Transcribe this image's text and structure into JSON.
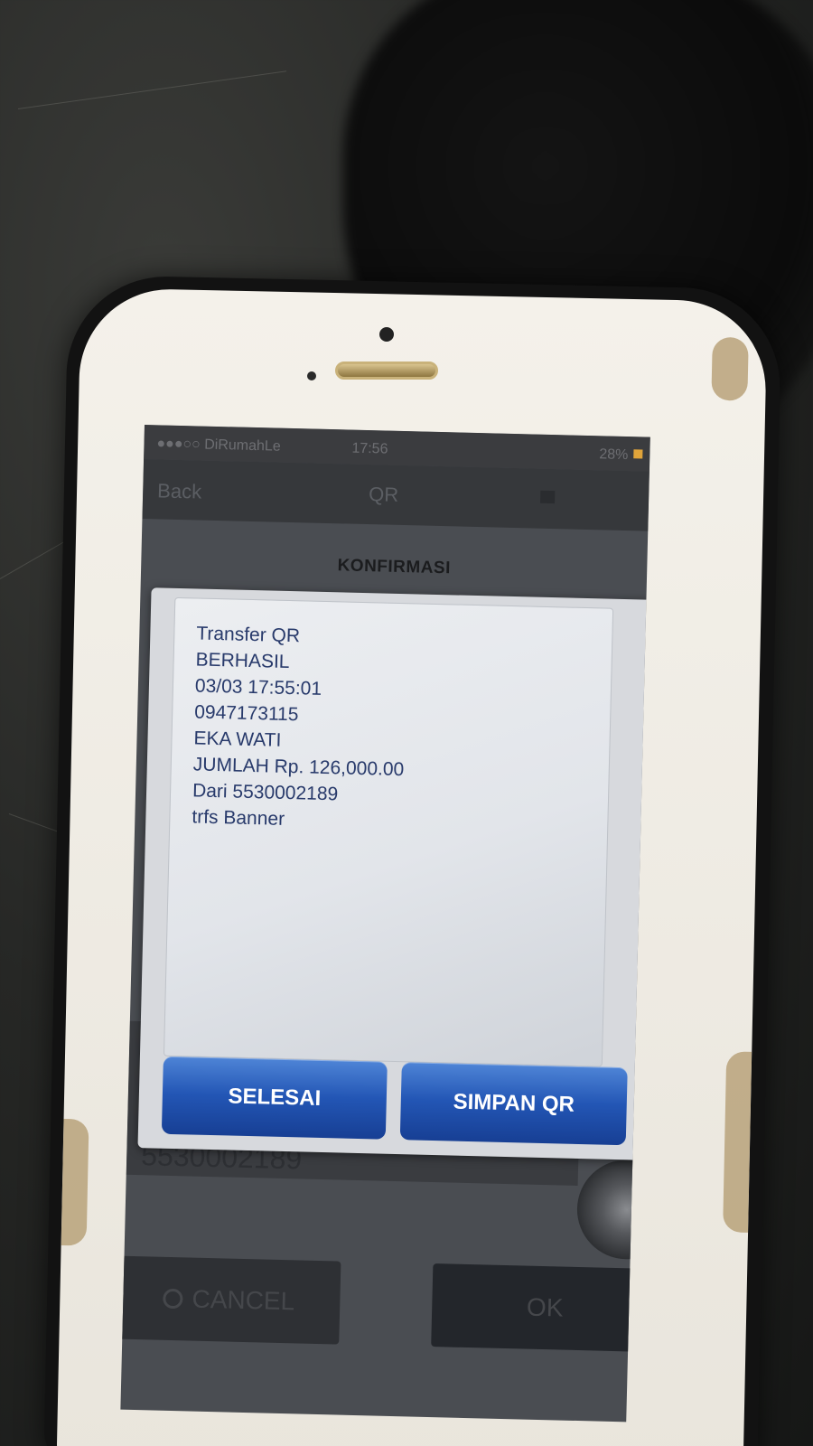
{
  "status_bar": {
    "carrier": "●●●○○ DiRumahLe",
    "time": "17:56",
    "battery": "28%"
  },
  "nav_bar": {
    "back_label": "Back",
    "title": "QR"
  },
  "screen_title": "KONFIRMASI",
  "dialog": {
    "lines": [
      "Transfer QR",
      "BERHASIL",
      "03/03 17:55:01",
      "0947173115",
      "EKA WATI",
      "JUMLAH Rp. 126,000.00",
      "Dari 5530002189",
      "trfs Banner"
    ],
    "done_button": "SELESAI",
    "save_qr_button": "SIMPAN QR"
  },
  "background_form": {
    "account_number": "5530002189",
    "cancel_button": "CANCEL",
    "ok_button": "OK"
  },
  "colors": {
    "button_blue": "#2356b5",
    "message_text": "#283a6b"
  }
}
